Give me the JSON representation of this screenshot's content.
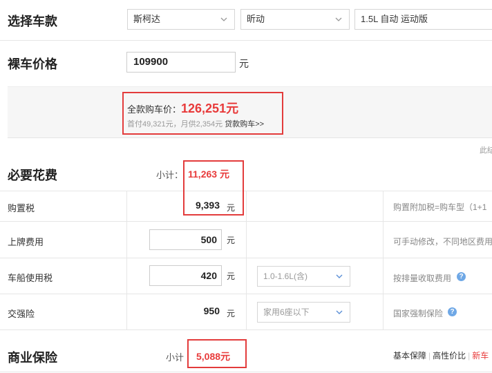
{
  "select_car": {
    "title": "选择车款",
    "brand": "斯柯达",
    "model": "昕动",
    "trim": "1.5L 自动 运动版"
  },
  "bare_price": {
    "title": "裸车价格",
    "value": "109900",
    "unit": "元"
  },
  "summary": {
    "full_price_label": "全款购车价：",
    "full_price_value": "126,251元",
    "loan_text": "首付49,321元，月供2,354元",
    "loan_link": "贷款购车>>"
  },
  "right_cut_text": "此结",
  "required_fees": {
    "title": "必要花费",
    "subtotal_label": "小计：",
    "subtotal_value": "11,263 元",
    "rows": [
      {
        "label": "购置税",
        "value": "9,393",
        "unit": "元",
        "note": "购置附加税=购车型（1+1"
      },
      {
        "label": "上牌费用",
        "value": "500",
        "unit": "元",
        "note": "可手动修改，不同地区费用"
      },
      {
        "label": "车船使用税",
        "value": "420",
        "unit": "元",
        "option": "1.0-1.6L(含)",
        "note": "按排量收取费用"
      },
      {
        "label": "交强险",
        "value": "950",
        "unit": "元",
        "option": "家用6座以下",
        "note": "国家强制保险"
      }
    ]
  },
  "commercial_insurance": {
    "title": "商业保险",
    "subtotal_label": "小计",
    "subtotal_value": "5,088元",
    "plans": [
      "基本保障",
      "高性价比",
      "新车"
    ]
  },
  "colors": {
    "accent_red": "#e83a3a",
    "box_red": "#e33b3b",
    "help_blue": "#6fa8e6"
  }
}
